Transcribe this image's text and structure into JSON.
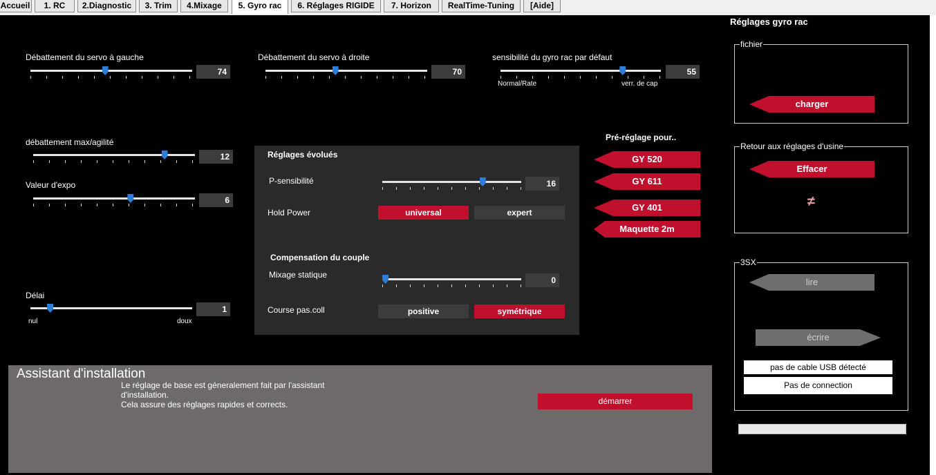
{
  "tabs": [
    {
      "label": "Accueil"
    },
    {
      "label": "1. RC"
    },
    {
      "label": "2.Diagnostic"
    },
    {
      "label": "3. Trim"
    },
    {
      "label": "4.Mixage"
    },
    {
      "label": "5. Gyro rac"
    },
    {
      "label": "6. Réglages RIGIDE"
    },
    {
      "label": "7. Horizon"
    },
    {
      "label": "RealTime-Tuning"
    },
    {
      "label": "[Aide]"
    }
  ],
  "active_tab": "5. Gyro rac",
  "colors": {
    "accent_red": "#c0102e",
    "slider_thumb": "#2f7fd8",
    "panel": "#2a2a2a",
    "value_box": "#3c3c3c",
    "assistant_bg": "#6d6a69"
  },
  "servo_left": {
    "label": "Débattement du servo à gauche",
    "value": "74",
    "level": 0.46
  },
  "servo_right": {
    "label": "Débattement du servo à droite",
    "value": "70",
    "level": 0.43
  },
  "gyro_default": {
    "label": "sensibilité du gyro rac par défaut",
    "value": "55",
    "level": 0.76,
    "min_label": "Normal/Rate",
    "max_label": "verr. de cap"
  },
  "max_agility": {
    "label": "débattement max/agilité",
    "value": "12",
    "level": 0.81
  },
  "expo": {
    "label": "Valeur d'expo",
    "value": "6",
    "level": 0.6
  },
  "delay": {
    "label": "Délai",
    "value": "1",
    "level": 0.12,
    "min_label": "nul",
    "max_label": "doux"
  },
  "advanced": {
    "title": "Réglages évolués",
    "p_sens": {
      "label": "P-sensibilité",
      "value": "16",
      "level": 0.72
    },
    "hold_power": {
      "label": "Hold Power",
      "option1": "universal",
      "option2": "expert",
      "selected": "universal"
    },
    "torque_title": "Compensation du couple",
    "static_mix": {
      "label": "Mixage statique",
      "value": "0",
      "level": 0.0
    },
    "coll": {
      "label": "Course pas.coll",
      "option1": "positive",
      "option2": "symétrique",
      "selected": "symétrique"
    }
  },
  "preset": {
    "title": "Pré-réglage pour..",
    "items": [
      "GY 520",
      "GY 611",
      "GY 401",
      "Maquette 2m"
    ]
  },
  "side": {
    "title": "Réglages gyro rac",
    "file_group": "fichier",
    "load": "charger",
    "factory_group": "Retour aux réglages d'usine",
    "erase": "Effacer",
    "neq_icon": "≠",
    "sx_group": "3SX",
    "read": "lire",
    "write": "écrire",
    "usb_status": "pas de cable USB détecté",
    "conn_status": "Pas de connection"
  },
  "assistant": {
    "title": "Assistant d'installation",
    "line1": "Le réglage de base est géneralement fait par l'assistant",
    "line2": "d'installation.",
    "line3": "Cela assure des réglages rapides et corrects.",
    "start": "démarrer"
  }
}
